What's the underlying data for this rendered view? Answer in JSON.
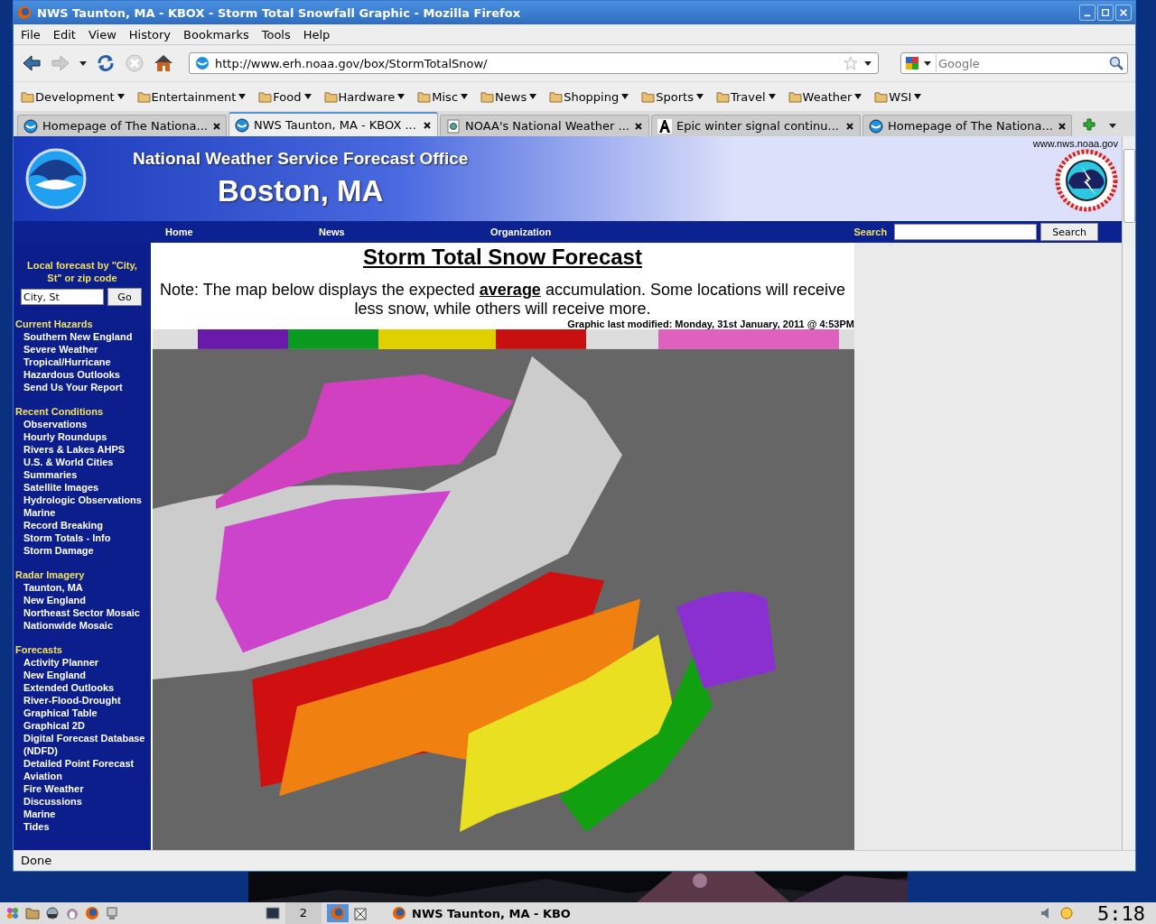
{
  "window": {
    "title": "NWS Taunton, MA - KBOX - Storm Total Snowfall Graphic - Mozilla Firefox"
  },
  "menu": [
    "File",
    "Edit",
    "View",
    "History",
    "Bookmarks",
    "Tools",
    "Help"
  ],
  "address": {
    "value": "http://www.erh.noaa.gov/box/StormTotalSnow/"
  },
  "search": {
    "placeholder": "Google"
  },
  "bookmarks": [
    "Development",
    "Entertainment",
    "Food",
    "Hardware",
    "Misc",
    "News",
    "Shopping",
    "Sports",
    "Travel",
    "Weather",
    "WSI"
  ],
  "tabs": [
    {
      "label": "Homepage of The Nationa...",
      "kind": "noaa",
      "selected": false
    },
    {
      "label": "NWS Taunton, MA - KBOX ...",
      "kind": "noaa",
      "selected": true
    },
    {
      "label": "NOAA's National Weather ...",
      "kind": "doc",
      "selected": false
    },
    {
      "label": "Epic winter signal continu...",
      "kind": "letter",
      "selected": false
    },
    {
      "label": "Homepage of The Nationa...",
      "kind": "noaa",
      "selected": false
    }
  ],
  "page": {
    "banner": {
      "office": "National Weather Service Forecast Office",
      "city": "Boston, MA",
      "site": "www.nws.noaa.gov"
    },
    "nav": [
      "Home",
      "News",
      "Organization"
    ],
    "site_search": {
      "label": "Search",
      "button": "Search"
    },
    "local_forecast": {
      "label": "Local forecast by \"City, St\" or zip code",
      "value": "City, St",
      "button": "Go"
    },
    "sidebar": [
      {
        "heading": "Current Hazards",
        "items": [
          "Southern New England",
          "Severe Weather",
          "Tropical/Hurricane",
          "Hazardous Outlooks",
          "Send Us Your Report"
        ]
      },
      {
        "heading": "Recent Conditions",
        "items": [
          "Observations",
          "Hourly Roundups",
          "Rivers & Lakes AHPS",
          "U.S. & World Cities",
          "Summaries",
          "Satellite Images",
          "Hydrologic Observations",
          "Marine",
          "Record Breaking",
          "Storm Totals - Info",
          "Storm Damage"
        ]
      },
      {
        "heading": "Radar Imagery",
        "items": [
          "Taunton, MA",
          "New England",
          "Northeast Sector Mosaic",
          "Nationwide Mosaic"
        ]
      },
      {
        "heading": "Forecasts",
        "items": [
          "Activity Planner",
          "New England",
          "Extended Outlooks",
          "River-Flood-Drought",
          "Graphical Table",
          "Graphical 2D",
          "Digital Forecast Database (NDFD)",
          "Detailed Point Forecast",
          "Aviation",
          "Fire Weather",
          "Discussions",
          "Marine",
          "Tides"
        ]
      }
    ],
    "title": "Storm Total Snow Forecast",
    "note": "Note: The map below displays the expected **average** accumulation. Some locations will receive less snow, while others will receive more.",
    "modified": "Graphic last modified: Monday, 31st January, 2011 @ 4:53PM",
    "map": {
      "kind": "picture"
    }
  },
  "status_bar": "Done",
  "taskbar": {
    "workspace": "2",
    "window": "NWS Taunton, MA - KBO",
    "clock": "5:18"
  }
}
